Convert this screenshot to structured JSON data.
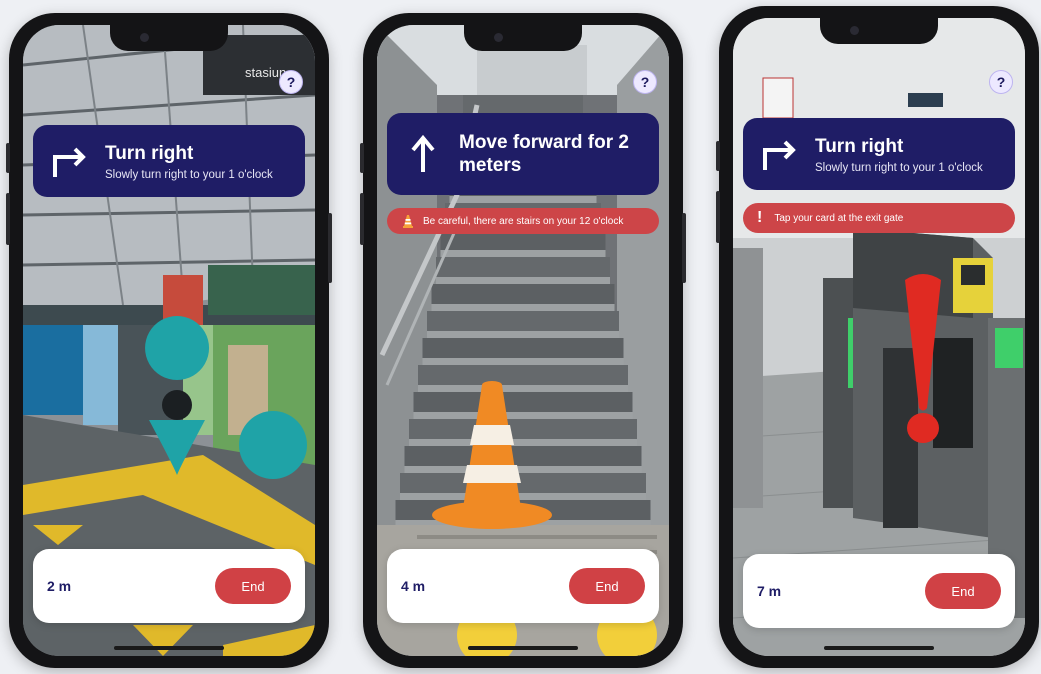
{
  "help_label": "?",
  "end_label": "End",
  "phones": [
    {
      "instruction_title": "Turn right",
      "instruction_subtitle": "Slowly turn right to your 1 o'clock",
      "distance": "2 m",
      "sign_text": "stasiun"
    },
    {
      "instruction_title": "Move forward for 2 meters",
      "warning": "Be careful, there are stairs on your 12 o'clock",
      "distance": "4 m"
    },
    {
      "instruction_title": "Turn right",
      "instruction_subtitle": "Slowly turn right to your 1 o'clock",
      "warning": "Tap your card at the exit gate",
      "distance": "7 m"
    }
  ],
  "colors": {
    "instruction_bg": "#1f1d66",
    "warning_bg": "#cd4548",
    "end_button": "#d04145",
    "marker_teal": "#1fa3a7",
    "cone_orange": "#f08a24",
    "exclamation_red": "#e02a22"
  }
}
